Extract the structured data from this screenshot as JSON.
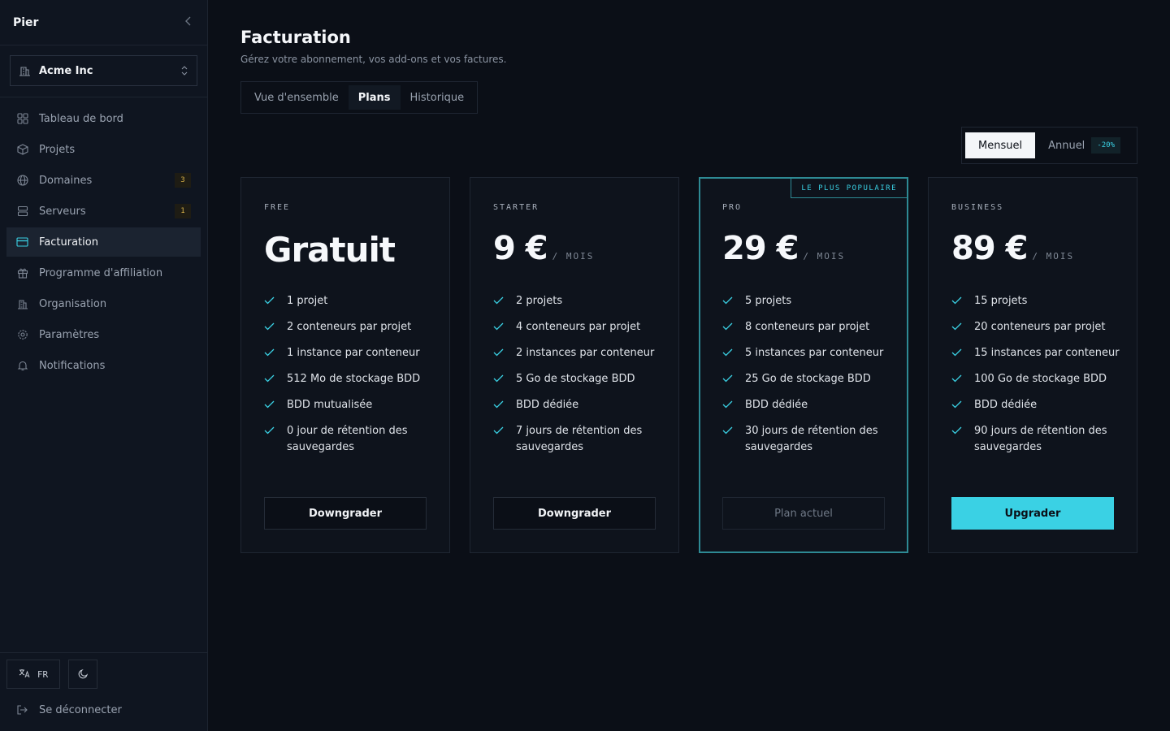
{
  "app": {
    "brand": "Pier"
  },
  "org": {
    "name": "Acme Inc"
  },
  "nav": [
    {
      "label": "Tableau de bord",
      "icon": "dashboard-icon"
    },
    {
      "label": "Projets",
      "icon": "box-icon"
    },
    {
      "label": "Domaines",
      "icon": "globe-icon",
      "badge": "3"
    },
    {
      "label": "Serveurs",
      "icon": "server-icon",
      "badge": "1"
    },
    {
      "label": "Facturation",
      "icon": "credit-card-icon",
      "active": true
    },
    {
      "label": "Programme d'affiliation",
      "icon": "gift-icon"
    },
    {
      "label": "Organisation",
      "icon": "building-icon"
    },
    {
      "label": "Paramètres",
      "icon": "gear-icon"
    },
    {
      "label": "Notifications",
      "icon": "bell-icon"
    }
  ],
  "footer": {
    "lang": "FR",
    "logout": "Se déconnecter"
  },
  "page": {
    "title": "Facturation",
    "subtitle": "Gérez votre abonnement, vos add-ons et vos factures.",
    "tabs": [
      {
        "label": "Vue d'ensemble"
      },
      {
        "label": "Plans",
        "active": true
      },
      {
        "label": "Historique"
      }
    ]
  },
  "billing": {
    "monthly": "Mensuel",
    "yearly": "Annuel",
    "discount": "-20%"
  },
  "plans": [
    {
      "tier": "FREE",
      "price": "Gratuit",
      "period": "",
      "features": [
        "1 projet",
        "2 conteneurs par projet",
        "1 instance par conteneur",
        "512 Mo de stockage BDD",
        "BDD mutualisée",
        "0 jour de rétention des sauvegardes"
      ],
      "button": "Downgrader"
    },
    {
      "tier": "STARTER",
      "price": "9 €",
      "period": "/ MOIS",
      "features": [
        "2 projets",
        "4 conteneurs par projet",
        "2 instances par conteneur",
        "5 Go de stockage BDD",
        "BDD dédiée",
        "7 jours de rétention des sauvegardes"
      ],
      "button": "Downgrader"
    },
    {
      "tier": "PRO",
      "price": "29 €",
      "period": "/ MOIS",
      "tag": "LE PLUS POPULAIRE",
      "features": [
        "5 projets",
        "8 conteneurs par projet",
        "5 instances par conteneur",
        "25 Go de stockage BDD",
        "BDD dédiée",
        "30 jours de rétention des sauvegardes"
      ],
      "button": "Plan actuel"
    },
    {
      "tier": "BUSINESS",
      "price": "89 €",
      "period": "/ MOIS",
      "features": [
        "15 projets",
        "20 conteneurs par projet",
        "15 instances par conteneur",
        "100 Go de stockage BDD",
        "BDD dédiée",
        "90 jours de rétention des sauvegardes"
      ],
      "button": "Upgrader"
    }
  ],
  "colors": {
    "accent": "#3ad1e4",
    "background": "#0b0f17",
    "sidebar": "#0f1520",
    "badge": "#d8b24a"
  }
}
